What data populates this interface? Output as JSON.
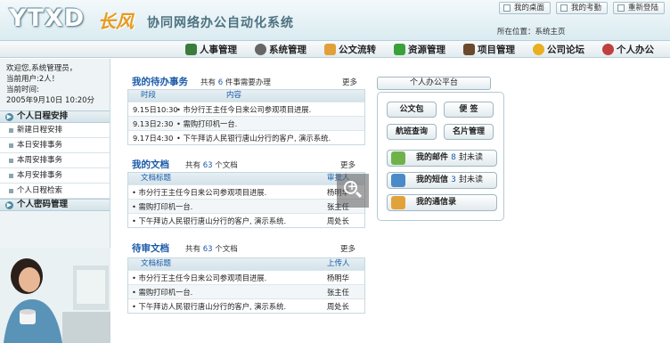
{
  "header": {
    "logo": "YTXD",
    "logo_cn": "长风",
    "system_title": "协同网络办公自动化系统",
    "top_links": [
      {
        "label": "我的桌面",
        "icon": "desktop-icon"
      },
      {
        "label": "我的考勤",
        "icon": "attendance-icon"
      },
      {
        "label": "重新登陆",
        "icon": "relogin-icon"
      }
    ],
    "location_label": "所在位置：",
    "location_value": "系统主页"
  },
  "nav": [
    {
      "label": "人事管理",
      "icon": "people-icon",
      "color": "#3a7d3a"
    },
    {
      "label": "系统管理",
      "icon": "gear-icon",
      "color": "#555555"
    },
    {
      "label": "公文流转",
      "icon": "folder-icon",
      "color": "#e0a13a"
    },
    {
      "label": "资源管理",
      "icon": "check-icon",
      "color": "#3aa13a"
    },
    {
      "label": "项目管理",
      "icon": "project-icon",
      "color": "#6a4a2a"
    },
    {
      "label": "公司论坛",
      "icon": "chat-icon",
      "color": "#e8b020"
    },
    {
      "label": "个人办公",
      "icon": "person-icon",
      "color": "#c04040"
    }
  ],
  "sidebar": {
    "welcome_line1": "欢迎您,系统管理员，",
    "welcome_line2": "当前用户:2人！",
    "welcome_line3": "当前时间:",
    "welcome_line4": "2005年9月10日 10:20分",
    "section1": "个人日程安排",
    "items": [
      "新建日程安排",
      "本日安排事务",
      "本周安排事务",
      "本月安排事务",
      "个人日程检索"
    ],
    "section2": "个人密码管理"
  },
  "todo": {
    "title": "我的待办事务",
    "count_prefix": "共有",
    "count": "6",
    "count_suffix": "件事需要办理",
    "more": "更多",
    "head_time": "时段",
    "head_content": "内容",
    "rows": [
      {
        "time": "9.15日10:30",
        "content": "• 市分行王主任今日来公司参观项目进展."
      },
      {
        "time": "9.13日2:30",
        "content": "• 需购打印机一台."
      },
      {
        "time": "9.17日4:30",
        "content": "• 下午拜访人民银行唐山分行的客户, 演示系统."
      }
    ]
  },
  "docs": {
    "title": "我的文档",
    "count_prefix": "共有",
    "count": "63",
    "count_suffix": "个文档",
    "more": "更多",
    "head_title": "文档标题",
    "head_person": "审批人",
    "rows": [
      {
        "title": "• 市分行王主任今日来公司参观项目进展.",
        "person": "杨明华"
      },
      {
        "title": "• 需购打印机一台.",
        "person": "张主任"
      },
      {
        "title": "• 下午拜访人民银行唐山分行的客户, 演示系统.",
        "person": "周处长"
      }
    ]
  },
  "review": {
    "title": "待审文档",
    "count_prefix": "共有",
    "count": "63",
    "count_suffix": "个文档",
    "more": "更多",
    "head_title": "文档标题",
    "head_person": "上传人",
    "rows": [
      {
        "title": "• 市分行王主任今日来公司参观项目进展.",
        "person": "杨明华"
      },
      {
        "title": "• 需购打印机一台.",
        "person": "张主任"
      },
      {
        "title": "• 下午拜访人民银行唐山分行的客户, 演示系统.",
        "person": "周处长"
      }
    ]
  },
  "platform": {
    "title": "个人办公平台",
    "btn_docs": "公文包",
    "btn_notes": "便 签",
    "btn_flight": "航班查询",
    "btn_cards": "名片管理",
    "mail_label": "我的邮件",
    "mail_count": "8",
    "mail_unit": "封未读",
    "sms_label": "我的短信",
    "sms_count": "3",
    "sms_unit": "封未读",
    "contacts_label": "我的通信录"
  }
}
